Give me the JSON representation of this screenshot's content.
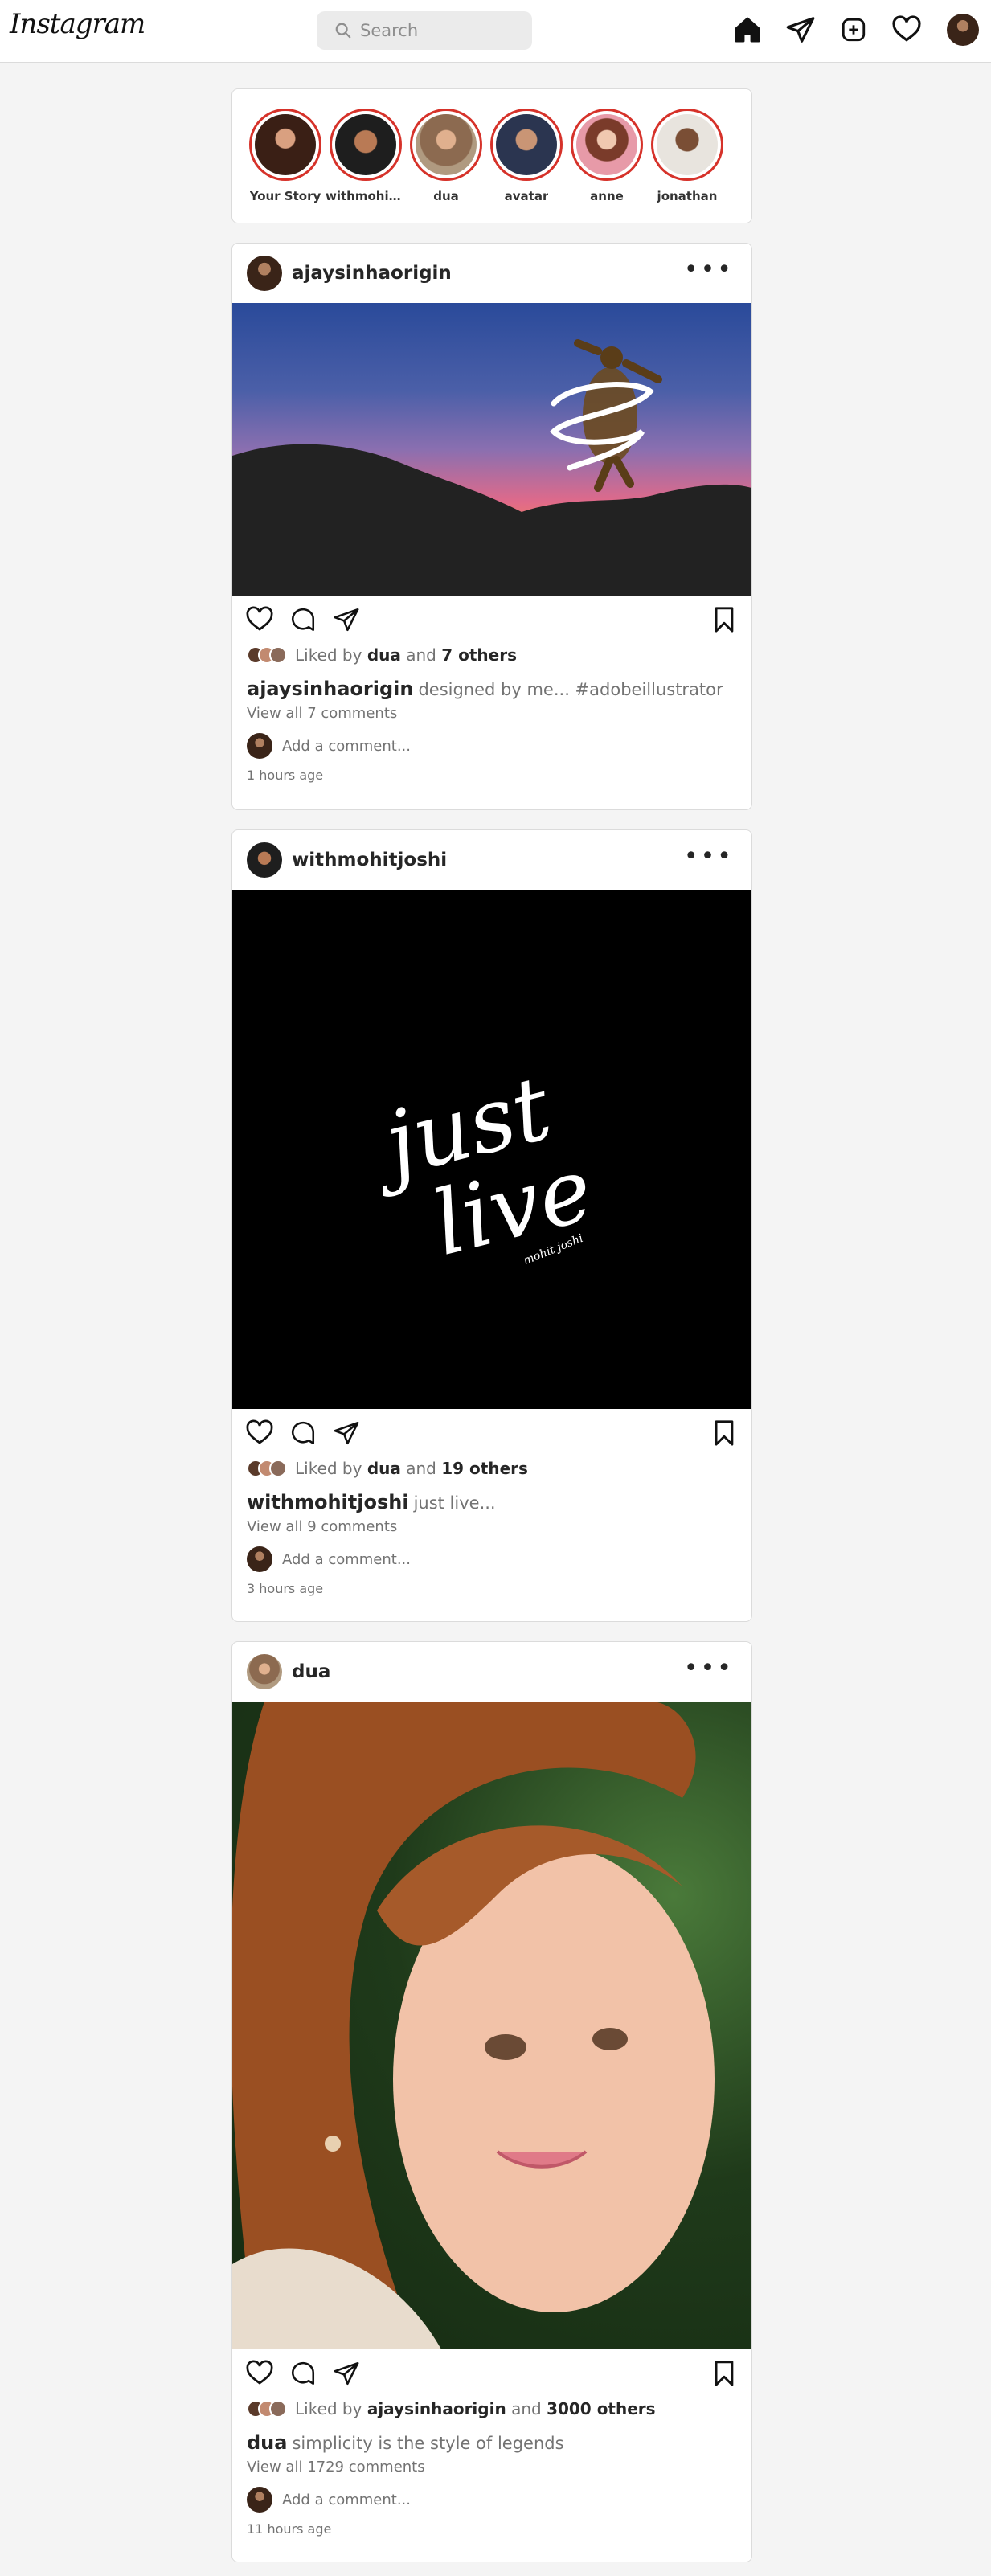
{
  "app": {
    "logo": "Instagram"
  },
  "search": {
    "placeholder": "Search"
  },
  "nav": {
    "icons": [
      "home-icon",
      "direct-icon",
      "new-post-icon",
      "activity-icon",
      "profile-avatar"
    ]
  },
  "stories": [
    {
      "name": "Your Story"
    },
    {
      "name": "withmohitjoshi"
    },
    {
      "name": "dua"
    },
    {
      "name": "avatar"
    },
    {
      "name": "anne"
    },
    {
      "name": "jonathan"
    }
  ],
  "posts": [
    {
      "user": "ajaysinhaorigin",
      "liked_by": "dua",
      "others": "7 others",
      "caption": "designed by me... #adobeillustrator",
      "view_all": "View all 7 comments",
      "comment_placeholder": "Add a comment...",
      "time": "1 hours age"
    },
    {
      "user": "withmohitjoshi",
      "liked_by": "dua",
      "others": "19 others",
      "caption": "just live...",
      "view_all": "View all 9 comments",
      "comment_placeholder": "Add a comment...",
      "time": "3 hours age",
      "art_text_1": "just",
      "art_text_2": "live",
      "art_sign": "mohit joshi"
    },
    {
      "user": "dua",
      "liked_by": "ajaysinhaorigin",
      "others": "3000 others",
      "caption": "simplicity is the style of legends",
      "view_all": "View all 1729 comments",
      "comment_placeholder": "Add a comment...",
      "time": "11 hours age"
    }
  ],
  "labels": {
    "liked_by": "Liked by",
    "and": "and"
  }
}
